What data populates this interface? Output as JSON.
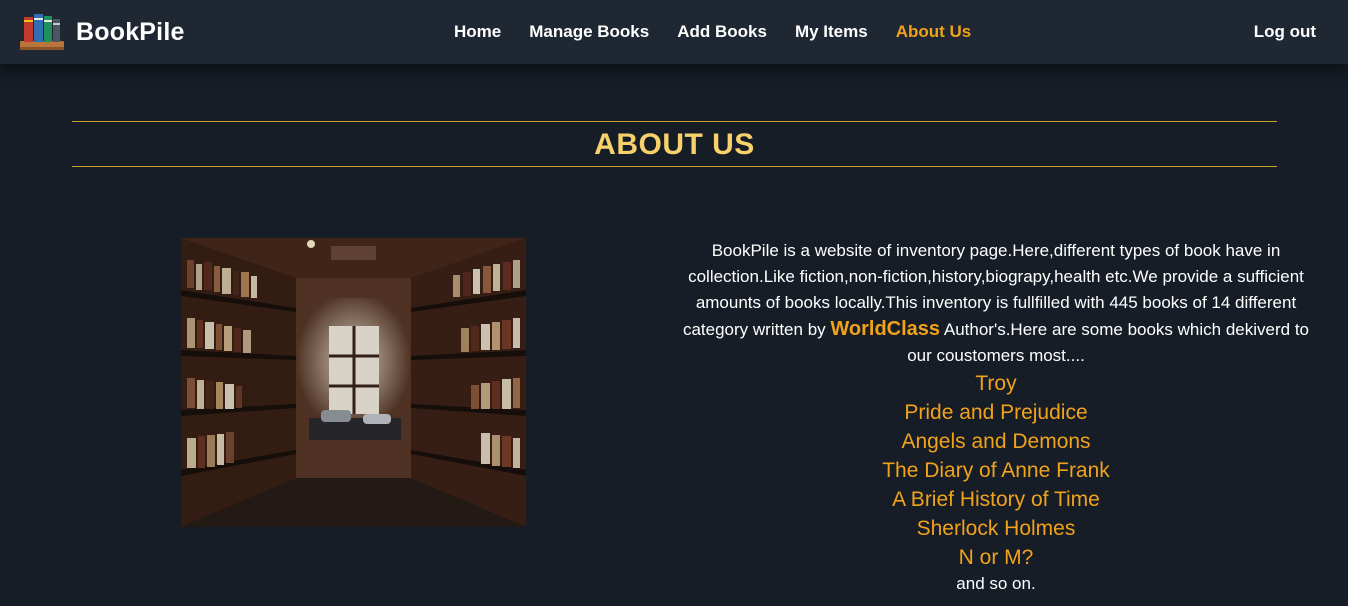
{
  "brand": {
    "name": "BookPile",
    "logo_icon": "bookshelf-icon"
  },
  "nav": {
    "items": [
      {
        "label": "Home",
        "active": false
      },
      {
        "label": "Manage Books",
        "active": false
      },
      {
        "label": "Add Books",
        "active": false
      },
      {
        "label": "My Items",
        "active": false
      },
      {
        "label": "About Us",
        "active": true
      }
    ],
    "logout_label": "Log out"
  },
  "about": {
    "heading": "ABOUT US",
    "image_subject": "bookstore-aisle-photo",
    "description_part1": "BookPile is a website of inventory page.Here,different types of book have in collection.Like fiction,non-fiction,history,biograpy,health etc.We provide a sufficient amounts of books locally.This inventory is fullfilled with 445 books of 14 different category written by",
    "highlight": "WorldClass",
    "description_part2": "Author's.Here are some books which dekiverd to our coustomers most....",
    "books": [
      "Troy",
      "Pride and Prejudice",
      "Angels and Demons",
      "The Diary of Anne Frank",
      "A Brief History of Time",
      "Sherlock Holmes",
      "N or M?"
    ],
    "closing": "and so on."
  },
  "colors": {
    "background": "#161d26",
    "navbar": "#1f2733",
    "accent": "#f0a21b",
    "heading": "#f7d26b",
    "rule": "#c9a227"
  }
}
